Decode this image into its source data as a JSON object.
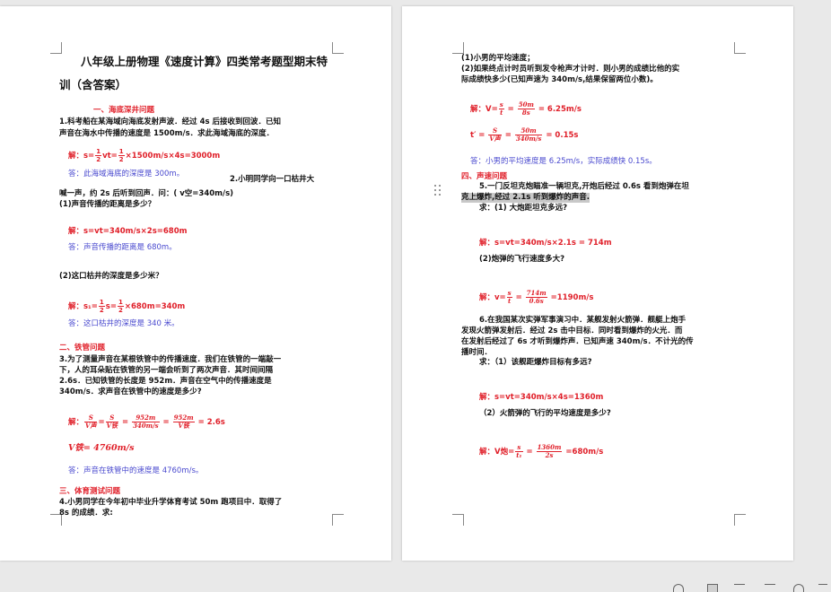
{
  "page1": {
    "title_line1": "八年级上册物理《速度计算》四类常考题型期末特",
    "title_line2": "训（含答案）",
    "sec1_heading": "一、海底深井问题",
    "q1_line1": "1.科考船在某海域向海底发射声波．经过 4s 后接收到回波．已知",
    "q1_line2": "声音在海水中传播的速度是 1500m/s．求此海域海底的深度．",
    "a1_sol_prefix": "解：s=",
    "a1_sol_mid": "vt=",
    "a1_sol_rest": "×1500m/s×4s=3000m",
    "a1_ans": "答：此海域海底的深度是 300m。",
    "q2_tail": "2.小明同学向一口枯井大",
    "q2_line2": "喊一声，约 2s 后听到回声．问：( v空=340m/s)",
    "q2_sub1": "(1)声音传播的距离是多少？",
    "a2_1_sol": "解：s=vt=340m/s×2s=680m",
    "a2_1_ans": "答：声音传播的距离是 680m。",
    "q2_sub2": "(2)这口枯井的深度是多少米？",
    "a2_2_sol_prefix": "解：s₁=",
    "a2_2_sol_mid": "s=",
    "a2_2_sol_rest": "×680m=340m",
    "a2_2_ans": "答：这口枯井的深度是 340 米。",
    "sec2_heading": "二、铁管问题",
    "q3_line1": "3.为了测量声音在某根铁管中的传播速度．我们在铁管的一端敲一",
    "q3_line2": "下，人的耳朵贴在铁管的另一端会听到了两次声音．其时间间隔",
    "q3_line3": "2.6s．已知铁管的长度是 952m．声音在空气中的传播速度是",
    "q3_line4": "340m/s．求声音在铁管中的速度是多少?",
    "a3_sol_prefix": "解：",
    "a3_frac1_n": "S",
    "a3_frac1_d": "V声",
    "a3_frac2_n": "S",
    "a3_frac2_d": "V铁",
    "a3_frac3_n": "952m",
    "a3_frac3_d": "340m/s",
    "a3_frac4_n": "952m",
    "a3_frac4_d": "V铁",
    "a3_sol_rest": "= 2.6s",
    "a3_result": "V铁= 4760m/s",
    "a3_ans": "答：声音在铁管中的速度是 4760m/s。",
    "sec3_heading": "三、体育测试问题",
    "q4_line1": "4.小男同学在今年初中毕业升学体育考试 50m 跑项目中．取得了",
    "q4_line2": "8s 的成绩．求:"
  },
  "page2": {
    "q4_sub1": "(1)小男的平均速度；",
    "q4_sub2_line1": "(2)如果终点计时员听到发令枪声才计时．则小男的成绩比他的实",
    "q4_sub2_line2": "际成绩快多少(已知声速为 340m/s,结果保留两位小数)。",
    "a4_sol1_prefix": "解：V=",
    "a4_sol1_frac1_n": "s",
    "a4_sol1_frac1_d": "t",
    "a4_sol1_frac2_n": "50m",
    "a4_sol1_frac2_d": "8s",
    "a4_sol1_rest": "= 6.25m/s",
    "a4_sol2_prefix": "t′ =",
    "a4_sol2_frac1_n": "S",
    "a4_sol2_frac1_d": "V声",
    "a4_sol2_frac2_n": "50m",
    "a4_sol2_frac2_d": "340m/s",
    "a4_sol2_rest": "= 0.15s",
    "a4_ans": "答：小男的平均速度是 6.25m/s，实际成绩快 0.15s。",
    "sec4_heading": "四、声速问题",
    "q5_line1": "5.一门反坦克炮瞄准一辆坦克,开炮后经过 0.6s 看到炮弹在坦",
    "q5_line2": "克上爆炸,经过 2.1s 听到爆炸的声音.",
    "q5_sub1": "求：(1) 大炮距坦克多远?",
    "a5_1_sol": "解：s=vt=340m/s×2.1s = 714m",
    "q5_sub2": "(2)炮弹的飞行速度多大?",
    "a5_2_sol_prefix": "解：v=",
    "a5_2_frac1_n": "s",
    "a5_2_frac1_d": "t",
    "a5_2_frac2_n": "714m",
    "a5_2_frac2_d": "0.6s",
    "a5_2_rest": "=1190m/s",
    "q6_line1": "6.在我国某次实弹军事演习中．某舰发射火箭弹．舰艇上炮手",
    "q6_line2": "发现火箭弹发射后．经过 2s 击中目标．同时看到爆炸的火光．而",
    "q6_line3": "在发射后经过了 6s 才听到爆炸声．已知声速 340m/s．不计光的传",
    "q6_line4": "播时间．",
    "q6_sub1": "求：（1）该舰距爆炸目标有多远?",
    "a6_1_sol": "解：s=vt=340m/s×4s=1360m",
    "q6_sub2": "（2）火箭弹的飞行的平均速度是多少?",
    "a6_2_sol_prefix": "解：V炮=",
    "a6_2_frac1_n": "s",
    "a6_2_frac1_d": "t₁",
    "a6_2_frac2_n": "1360m",
    "a6_2_frac2_d": "2s",
    "a6_2_rest": "=680m/s"
  },
  "colors": {
    "solution": "#e0202a",
    "answer": "#4a4acf",
    "heading": "#c0283a"
  }
}
